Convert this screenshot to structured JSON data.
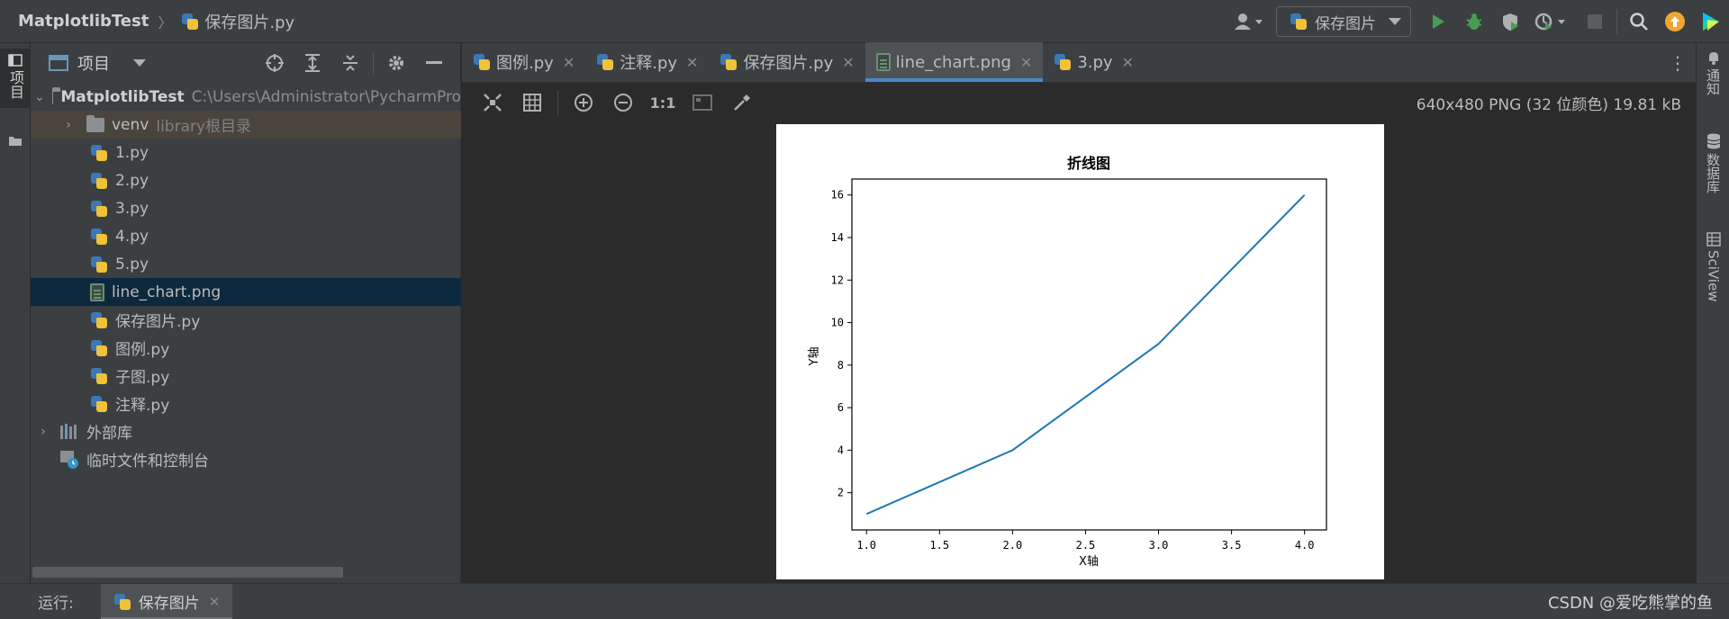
{
  "titlebar": {
    "project_name": "MatplotlibTest",
    "current_file": "保存图片.py",
    "run_config": "保存图片"
  },
  "leftstrip": {
    "project_tab": "项目"
  },
  "project_panel": {
    "title": "项目",
    "root": {
      "name": "MatplotlibTest",
      "path": "C:\\Users\\Administrator\\PycharmPro"
    },
    "venv": {
      "name": "venv",
      "hint": "library根目录"
    },
    "files": [
      {
        "name": "1.py",
        "type": "py"
      },
      {
        "name": "2.py",
        "type": "py"
      },
      {
        "name": "3.py",
        "type": "py"
      },
      {
        "name": "4.py",
        "type": "py"
      },
      {
        "name": "5.py",
        "type": "py"
      },
      {
        "name": "line_chart.png",
        "type": "png"
      },
      {
        "name": "保存图片.py",
        "type": "py"
      },
      {
        "name": "图例.py",
        "type": "py"
      },
      {
        "name": "子图.py",
        "type": "py"
      },
      {
        "name": "注释.py",
        "type": "py"
      }
    ],
    "external_libs": "外部库",
    "scratches": "临时文件和控制台"
  },
  "editor": {
    "tabs": [
      {
        "label": "图例.py",
        "type": "py"
      },
      {
        "label": "注释.py",
        "type": "py"
      },
      {
        "label": "保存图片.py",
        "type": "py"
      },
      {
        "label": "line_chart.png",
        "type": "png"
      },
      {
        "label": "3.py",
        "type": "py"
      }
    ],
    "active_tab": 3,
    "image_info": "640x480 PNG (32 位颜色) 19.81 kB",
    "zoom_label": "1:1"
  },
  "rightstrip": {
    "notifications": "通知",
    "database": "数据库",
    "sciview": "SciView"
  },
  "bottombar": {
    "run_label": "运行:",
    "run_tab": "保存图片",
    "watermark": "CSDN @爱吃熊掌的鱼"
  },
  "colors": {
    "accent_tab": "#4a88c7",
    "line": "#1f77b4",
    "selection": "#0d293e",
    "venv_bg": "#49453d"
  },
  "chart_data": {
    "type": "line",
    "title": "折线图",
    "xlabel": "X轴",
    "ylabel": "Y轴",
    "x": [
      1.0,
      2.0,
      3.0,
      4.0
    ],
    "y": [
      1,
      4,
      9,
      16
    ],
    "xlim": [
      0.9,
      4.15
    ],
    "ylim": [
      0.25,
      16.75
    ],
    "xticks": [
      "1.0",
      "1.5",
      "2.0",
      "2.5",
      "3.0",
      "3.5",
      "4.0"
    ],
    "xtick_values": [
      1.0,
      1.5,
      2.0,
      2.5,
      3.0,
      3.5,
      4.0
    ],
    "yticks": [
      "2",
      "4",
      "6",
      "8",
      "10",
      "12",
      "14",
      "16"
    ],
    "ytick_values": [
      2,
      4,
      6,
      8,
      10,
      12,
      14,
      16
    ],
    "grid": false
  }
}
